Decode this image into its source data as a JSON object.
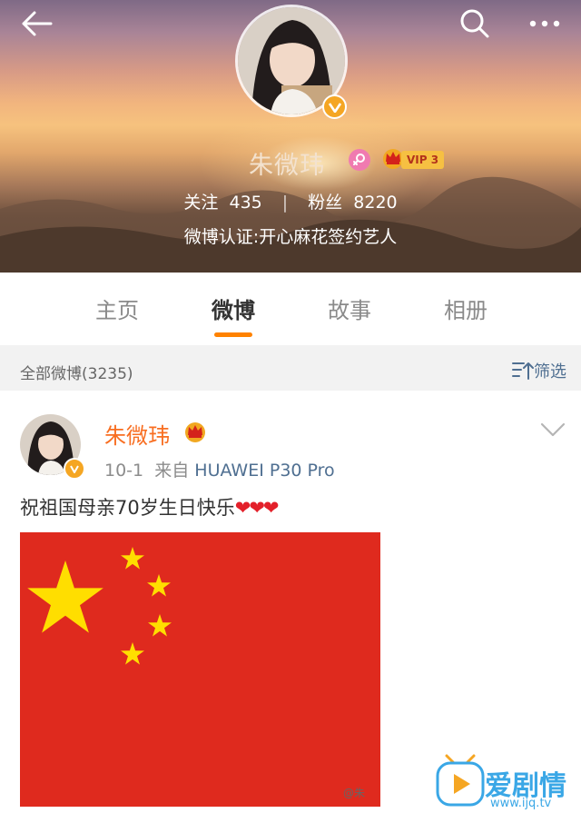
{
  "header": {
    "username": "朱微玮",
    "vip_label": "VIP 3",
    "following_label": "关注",
    "following_count": "435",
    "followers_label": "粉丝",
    "followers_count": "8220",
    "verification": "微博认证:开心麻花签约艺人"
  },
  "icons": {
    "back": "back-arrow-icon",
    "search": "search-icon",
    "more": "more-dots-icon",
    "gender": "female-icon",
    "crown": "crown-icon",
    "verified": "verified-v-icon",
    "filter": "filter-icon",
    "chevron": "chevron-down-icon"
  },
  "tabs": [
    {
      "label": "主页",
      "active": false
    },
    {
      "label": "微博",
      "active": true
    },
    {
      "label": "故事",
      "active": false
    },
    {
      "label": "相册",
      "active": false
    }
  ],
  "filterbar": {
    "all_posts": "全部微博(3235)",
    "filter_label": "筛选"
  },
  "post": {
    "author": "朱微玮",
    "date": "10-1",
    "from_label": "来自",
    "source": "HUAWEI P30 Pro",
    "text": "祝祖国母亲70岁生日快乐",
    "hearts": "❤❤❤",
    "image_watermark": "@朱"
  },
  "watermark": {
    "site_name": "爱剧情",
    "site_url": "www.ijq.tv"
  },
  "colors": {
    "accent": "#ff8200",
    "username_orange": "#f86e21",
    "link_blue": "#4f6f91",
    "flag_red": "#df2a1e",
    "flag_yellow": "#ffde00",
    "vip_gold": "#f6c042"
  }
}
